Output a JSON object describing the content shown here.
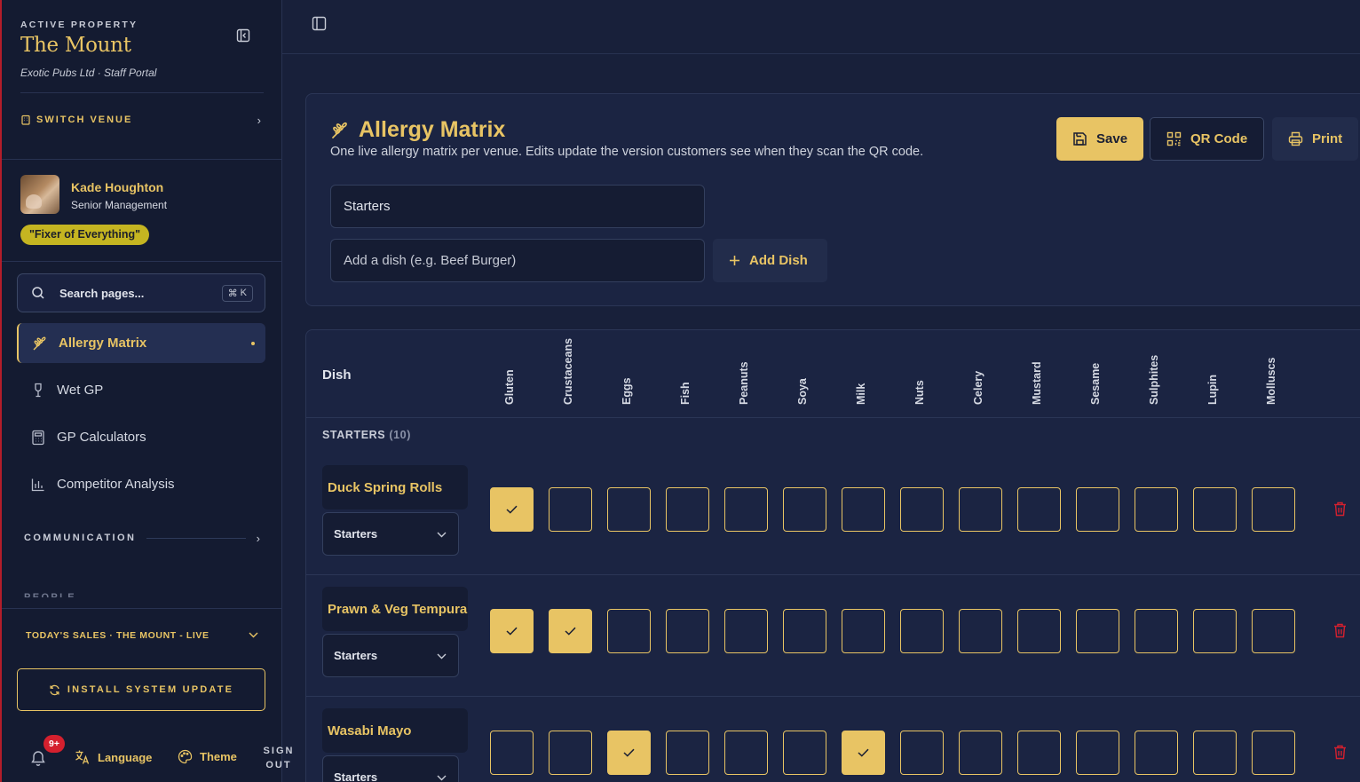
{
  "sidebar": {
    "active_property_label": "ACTIVE PROPERTY",
    "property_name": "The Mount",
    "property_sub": "Exotic Pubs Ltd · Staff Portal",
    "switch_venue": "SWITCH VENUE",
    "user": {
      "name": "Kade Houghton",
      "role": "Senior Management",
      "motto": "\"Fixer of Everything\""
    },
    "search": {
      "placeholder": "Search pages...",
      "shortcut_key": "K"
    },
    "nav": [
      {
        "label": "Allergy Matrix",
        "icon": "wheat-icon",
        "active": true
      },
      {
        "label": "Wet GP",
        "icon": "wine-glass-icon",
        "active": false
      },
      {
        "label": "GP Calculators",
        "icon": "calculator-icon",
        "active": false
      },
      {
        "label": "Competitor Analysis",
        "icon": "bar-chart-icon",
        "active": false
      }
    ],
    "communication_label": "COMMUNICATION",
    "people_label": "PEOPLE",
    "sales_label": "TODAY'S SALES · THE MOUNT - LIVE",
    "install_label": "INSTALL SYSTEM UPDATE",
    "notif_badge": "9+",
    "language_label": "Language",
    "theme_label": "Theme",
    "signout_line1": "SIGN",
    "signout_line2": "OUT"
  },
  "colors": {
    "accent": "#e8c464",
    "background": "#18203a",
    "sidebar": "#141b31",
    "danger": "#d4202e"
  },
  "header": {
    "title": "Allergy Matrix",
    "subtitle": "One live allergy matrix per venue. Edits update the version customers see when they scan the QR code.",
    "save_label": "Save",
    "qr_label": "QR Code",
    "print_label": "Print"
  },
  "form": {
    "category_value": "Starters",
    "dish_placeholder": "Add a dish (e.g. Beef Burger)",
    "add_dish_label": "Add Dish"
  },
  "table": {
    "dish_header": "Dish",
    "allergens": [
      "Gluten",
      "Crustaceans",
      "Eggs",
      "Fish",
      "Peanuts",
      "Soya",
      "Milk",
      "Nuts",
      "Celery",
      "Mustard",
      "Sesame",
      "Sulphites",
      "Lupin",
      "Molluscs"
    ],
    "section_name": "STARTERS",
    "section_count": "(10)",
    "rows": [
      {
        "name": "Duck Spring Rolls",
        "category": "Starters",
        "checked": [
          true,
          false,
          false,
          false,
          false,
          false,
          false,
          false,
          false,
          false,
          false,
          false,
          false,
          false
        ]
      },
      {
        "name": "Prawn & Veg Tempura",
        "category": "Starters",
        "checked": [
          true,
          true,
          false,
          false,
          false,
          false,
          false,
          false,
          false,
          false,
          false,
          false,
          false,
          false
        ]
      },
      {
        "name": "Wasabi Mayo",
        "category": "Starters",
        "checked": [
          false,
          false,
          true,
          false,
          false,
          false,
          true,
          false,
          false,
          false,
          false,
          false,
          false,
          false
        ]
      }
    ]
  }
}
